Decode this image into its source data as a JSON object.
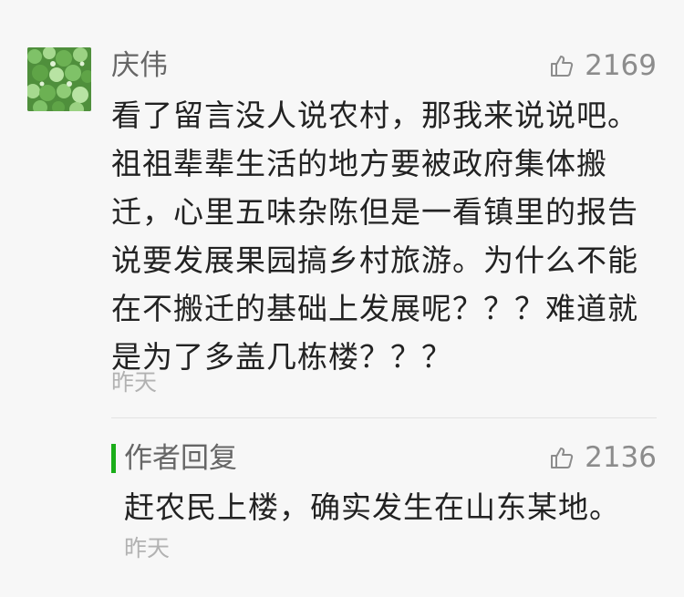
{
  "comment": {
    "username": "庆伟",
    "likes": "2169",
    "text": "看了留言没人说农村，那我来说说吧。祖祖辈辈生活的地方要被政府集体搬迁，心里五味杂陈但是一看镇里的报告说要发展果园搞乡村旅游。为什么不能在不搬迁的基础上发展呢？？？难道就是为了多盖几栋楼？？？",
    "time": "昨天"
  },
  "reply": {
    "title": "作者回复",
    "likes": "2136",
    "text": "赶农民上楼，确实发生在山东某地。",
    "time": "昨天"
  },
  "icons": {
    "like": "thumbs-up-icon",
    "avatar": "clover-avatar"
  },
  "colors": {
    "accent_green": "#1aad19",
    "meta_gray": "#8c8c8c"
  }
}
